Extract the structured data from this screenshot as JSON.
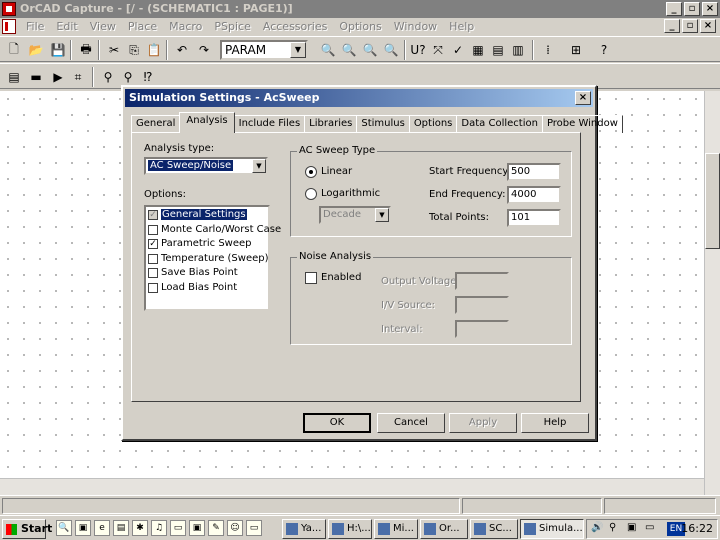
{
  "window": {
    "title": "OrCAD Capture - [/ - (SCHEMATIC1 : PAGE1)]"
  },
  "menu": [
    "File",
    "Edit",
    "View",
    "Place",
    "Macro",
    "PSpice",
    "Accessories",
    "Options",
    "Window",
    "Help"
  ],
  "toolbar": {
    "part_combo_value": "PARAM"
  },
  "dialog": {
    "title": "Simulation Settings - AcSweep",
    "close_glyph": "×",
    "tabs": [
      "General",
      "Analysis",
      "Include Files",
      "Libraries",
      "Stimulus",
      "Options",
      "Data Collection",
      "Probe Window"
    ],
    "selected_tab": "Analysis",
    "analysis_type_label": "Analysis type:",
    "analysis_type_value": "AC Sweep/Noise",
    "options_label": "Options:",
    "options": [
      {
        "label": "General Settings",
        "checked": true,
        "selected": true
      },
      {
        "label": "Monte Carlo/Worst Case",
        "checked": false,
        "selected": false
      },
      {
        "label": "Parametric Sweep",
        "checked": true,
        "selected": false
      },
      {
        "label": "Temperature (Sweep)",
        "checked": false,
        "selected": false
      },
      {
        "label": "Save Bias Point",
        "checked": false,
        "selected": false
      },
      {
        "label": "Load Bias Point",
        "checked": false,
        "selected": false
      }
    ],
    "ac_sweep": {
      "title": "AC Sweep Type",
      "linear_label": "Linear",
      "log_label": "Logarithmic",
      "selected": "Linear",
      "log_scale_value": "Decade",
      "start_label": "Start Frequency:",
      "start_value": "500",
      "end_label": "End Frequency:",
      "end_value": "4000",
      "points_label": "Total Points:",
      "points_value": "101"
    },
    "noise": {
      "title": "Noise Analysis",
      "enabled_label": "Enabled",
      "enabled": false,
      "output_label": "Output Voltage:",
      "source_label": "I/V Source:",
      "interval_label": "Interval:"
    },
    "buttons": {
      "ok": "OK",
      "cancel": "Cancel",
      "apply": "Apply",
      "help": "Help"
    }
  },
  "taskbar": {
    "start": "Start",
    "tasks": [
      "Ya...",
      "H:\\...",
      "Mi...",
      "Or...",
      "SC...",
      "Simula..."
    ],
    "language": "EN",
    "clock": "16:22"
  },
  "colors": {
    "active_title": "#0a246a",
    "selection": "#0a246a",
    "face": "#d4d0c8"
  }
}
